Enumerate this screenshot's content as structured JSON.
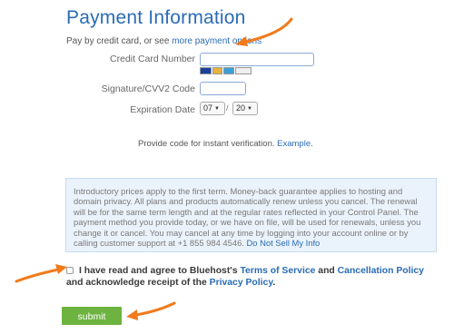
{
  "header": {
    "title": "Payment Information"
  },
  "pay_by": {
    "prefix": "Pay by credit card, or see ",
    "link": "more payment options"
  },
  "form": {
    "cc_label": "Credit Card Number",
    "cvv_label": "Signature/CVV2 Code",
    "exp_label": "Expiration Date",
    "month_value": "07",
    "year_value": "20",
    "date_separator": "/",
    "card_logos": [
      "visa-card-logo",
      "mastercard-logo",
      "amex-logo",
      "discover-logo"
    ]
  },
  "verify": {
    "text": "Provide code for instant verification. ",
    "link": "Example."
  },
  "notice": {
    "text": "Introductory prices apply to the first term. Money-back guarantee applies to hosting and domain privacy. All plans and products automatically renew unless you cancel. The renewal will be for the same term length and at the regular rates reflected in your Control Panel. The payment method you provide today, or we have on file, will be used for renewals, unless you change it or cancel. You may cancel at any time by logging into your account online or by calling customer support at +1 855 984 4546. ",
    "link": "Do Not Sell My Info"
  },
  "agreement": {
    "part1": "I have read and agree to Bluehost's ",
    "terms_link": "Terms of Service",
    "part2": " and ",
    "cancel_link": "Cancellation Policy",
    "part3": " and acknowledge receipt of the ",
    "privacy_link": "Privacy Policy",
    "part4": "."
  },
  "submit": {
    "label": "submit"
  },
  "colors": {
    "title": "#2a6cb5",
    "link": "#2a6cb5",
    "submit_bg": "#6db33f",
    "arrow": "#f07b1d",
    "notice_bg": "#eaf2fb"
  }
}
